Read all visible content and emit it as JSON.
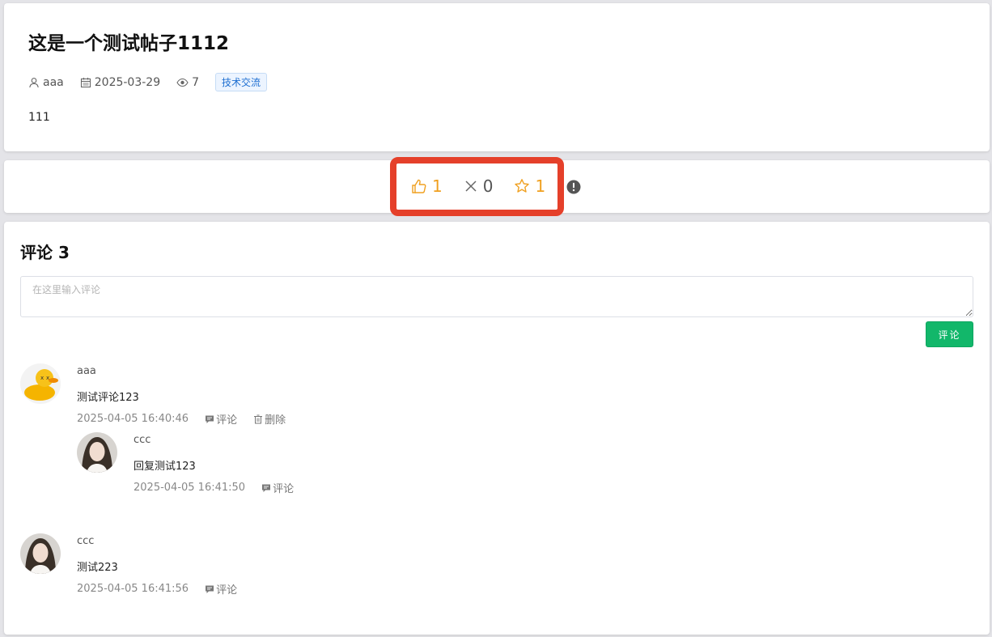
{
  "post": {
    "title": "这是一个测试帖子1112",
    "author": "aaa",
    "date": "2025-03-29",
    "views": "7",
    "tag": "技术交流",
    "content": "111"
  },
  "actions": {
    "likes": "1",
    "dislikes": "0",
    "favorites": "1"
  },
  "comments_section": {
    "title": "评论 3",
    "input_placeholder": "在这里输入评论",
    "submit_label": "评论",
    "comments": [
      {
        "user": "aaa",
        "text": "测试评论123",
        "time": "2025-04-05 16:40:46",
        "reply_label": "评论",
        "delete_label": "删除",
        "replies": [
          {
            "user": "ccc",
            "text": "回复测试123",
            "time": "2025-04-05 16:41:50",
            "reply_label": "评论"
          }
        ]
      },
      {
        "user": "ccc",
        "text": "测试223",
        "time": "2025-04-05 16:41:56",
        "reply_label": "评论"
      }
    ]
  },
  "colors": {
    "accent_orange": "#f0a020",
    "submit_green": "#12b76a",
    "highlight_red": "#e5402a",
    "tag_blue": "#1f6fd1"
  }
}
